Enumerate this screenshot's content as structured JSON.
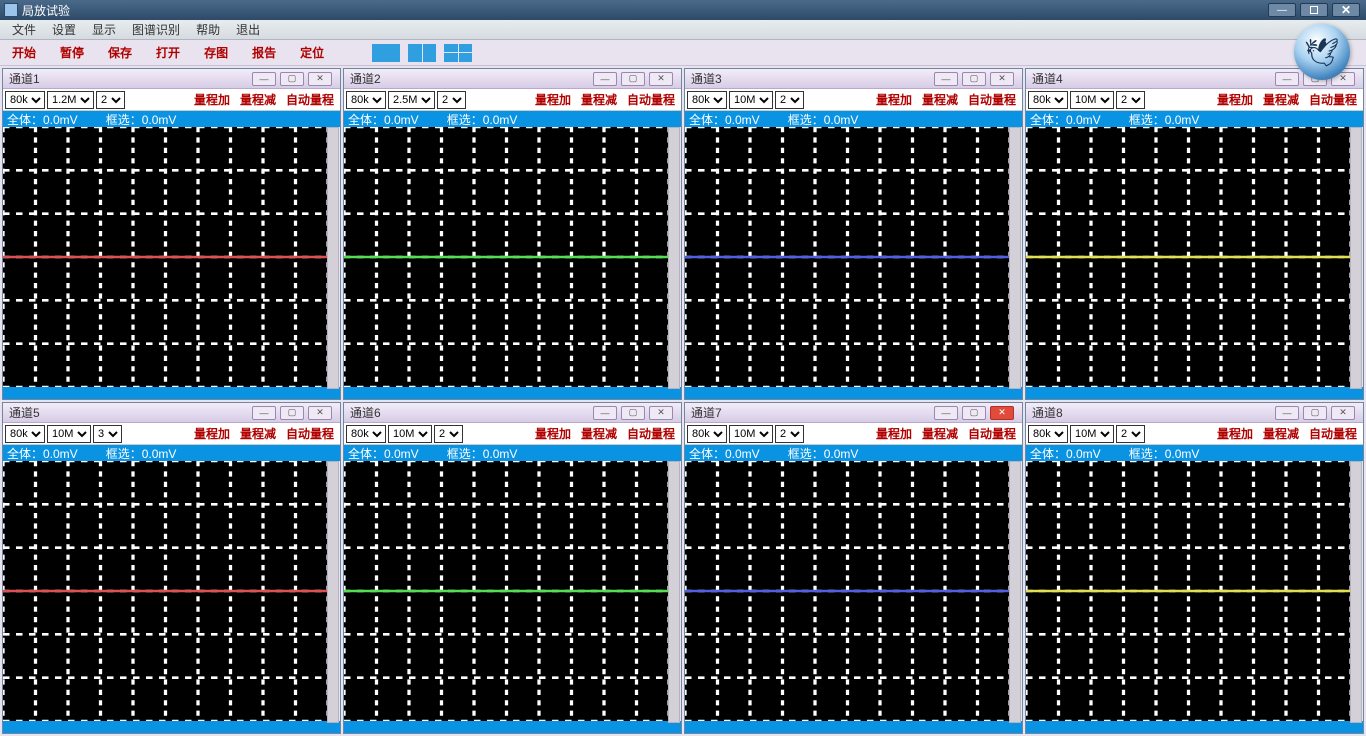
{
  "app_title": "局放试验",
  "menus": [
    "文件",
    "设置",
    "显示",
    "图谱识别",
    "帮助",
    "退出"
  ],
  "toolbar": [
    "开始",
    "暂停",
    "保存",
    "打开",
    "存图",
    "报告",
    "定位"
  ],
  "range_btns": {
    "inc": "量程加",
    "dec": "量程减",
    "auto": "自动量程"
  },
  "info_labels": {
    "all": "全体：",
    "sel": "框选："
  },
  "channels": [
    {
      "title": "通道1",
      "sel1": "80k",
      "sel2": "1.2M",
      "sel3": "2",
      "all": "0.0mV",
      "sel": "0.0mV",
      "trace": "#e05050",
      "close_red": false
    },
    {
      "title": "通道2",
      "sel1": "80k",
      "sel2": "2.5M",
      "sel3": "2",
      "all": "0.0mV",
      "sel": "0.0mV",
      "trace": "#50e050",
      "close_red": false
    },
    {
      "title": "通道3",
      "sel1": "80k",
      "sel2": "10M",
      "sel3": "2",
      "all": "0.0mV",
      "sel": "0.0mV",
      "trace": "#5060e0",
      "close_red": false
    },
    {
      "title": "通道4",
      "sel1": "80k",
      "sel2": "10M",
      "sel3": "2",
      "all": "0.0mV",
      "sel": "0.0mV",
      "trace": "#e0e050",
      "close_red": false
    },
    {
      "title": "通道5",
      "sel1": "80k",
      "sel2": "10M",
      "sel3": "3",
      "all": "0.0mV",
      "sel": "0.0mV",
      "trace": "#e05050",
      "close_red": false
    },
    {
      "title": "通道6",
      "sel1": "80k",
      "sel2": "10M",
      "sel3": "2",
      "all": "0.0mV",
      "sel": "0.0mV",
      "trace": "#50e050",
      "close_red": false
    },
    {
      "title": "通道7",
      "sel1": "80k",
      "sel2": "10M",
      "sel3": "2",
      "all": "0.0mV",
      "sel": "0.0mV",
      "trace": "#5060e0",
      "close_red": true
    },
    {
      "title": "通道8",
      "sel1": "80k",
      "sel2": "10M",
      "sel3": "2",
      "all": "0.0mV",
      "sel": "0.0mV",
      "trace": "#e0e050",
      "close_red": false
    }
  ]
}
